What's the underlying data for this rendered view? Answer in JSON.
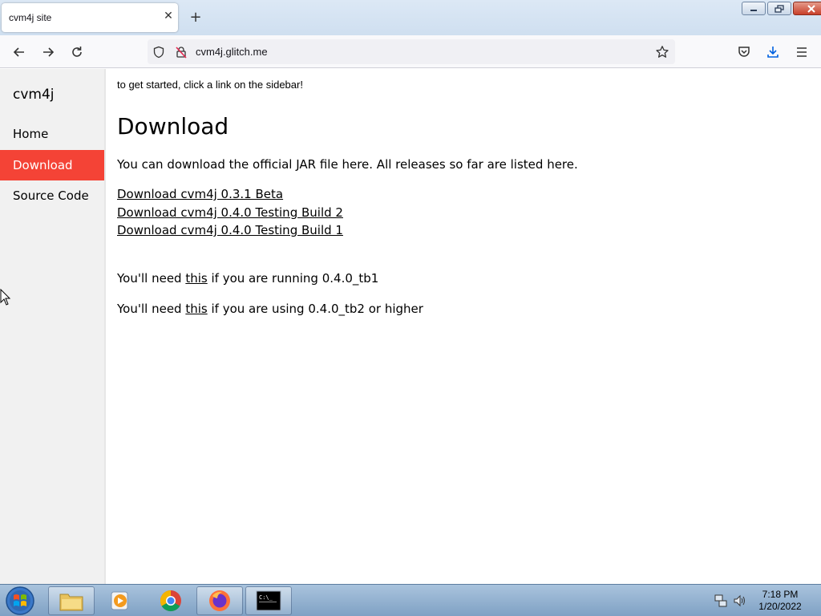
{
  "browser": {
    "tab_title": "cvm4j site",
    "tab_close": "✕",
    "new_tab": "+",
    "url": "cvm4j.glitch.me"
  },
  "site": {
    "name": "cvm4j",
    "sidebar": [
      {
        "label": "Home",
        "active": false
      },
      {
        "label": "Download",
        "active": true
      },
      {
        "label": "Source Code",
        "active": false
      }
    ],
    "active_color": "#f44336"
  },
  "page": {
    "intro": "to get started, click a link on the sidebar!",
    "heading": "Download",
    "description": "You can download the official JAR file here. All releases so far are listed here.",
    "downloads": [
      "Download cvm4j 0.3.1 Beta",
      "Download cvm4j 0.4.0 Testing Build 2",
      "Download cvm4j 0.4.0 Testing Build 1"
    ],
    "note1": {
      "before": "You'll need ",
      "link": "this",
      "after": " if you are running 0.4.0_tb1"
    },
    "note2": {
      "before": "You'll need ",
      "link": "this",
      "after": " if you are using 0.4.0_tb2 or higher"
    }
  },
  "taskbar": {
    "time": "7:18 PM",
    "date": "1/20/2022",
    "items": [
      "file-explorer-icon",
      "media-player-icon",
      "chrome-icon",
      "firefox-icon",
      "cmd-icon"
    ]
  }
}
